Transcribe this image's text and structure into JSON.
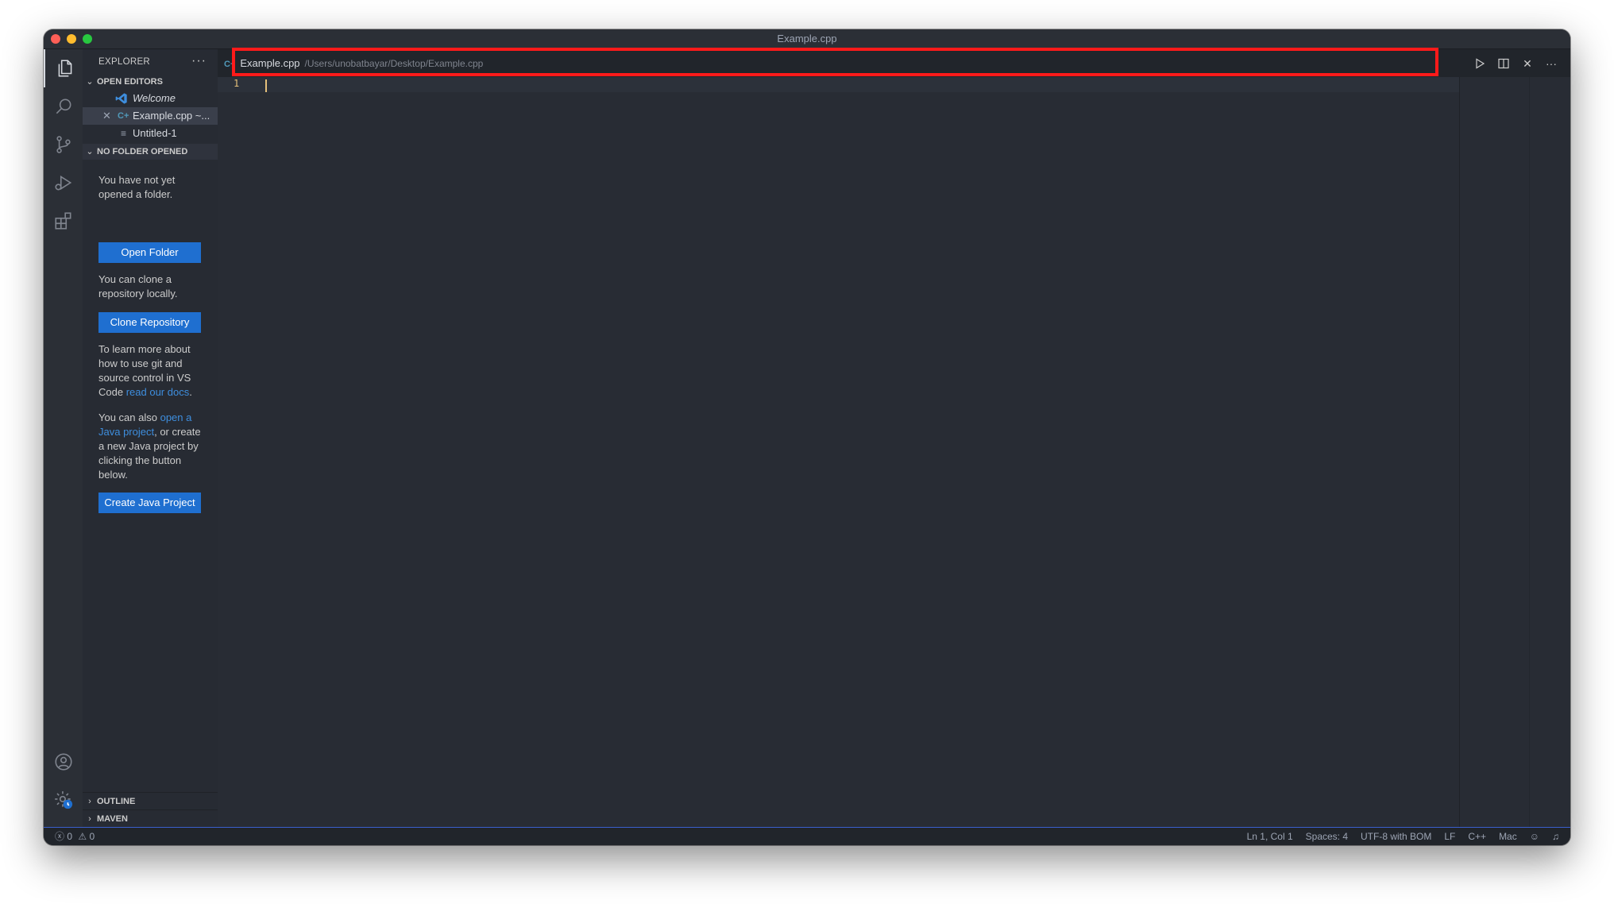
{
  "window": {
    "title": "Example.cpp"
  },
  "activity_bar": {
    "icons": [
      "files-icon",
      "search-icon",
      "source-control-icon",
      "run-debug-icon",
      "extensions-icon",
      "account-icon",
      "settings-gear-icon"
    ]
  },
  "sidebar": {
    "title": "EXPLORER",
    "more": "···",
    "open_editors": {
      "header": "OPEN EDITORS",
      "items": [
        {
          "label": "Welcome"
        },
        {
          "label": "Example.cpp ~..."
        },
        {
          "label": "Untitled-1"
        }
      ]
    },
    "no_folder": {
      "header": "NO FOLDER OPENED",
      "text1": "You have not yet opened a folder.",
      "open_folder_button": "Open Folder",
      "text2": "You can clone a repository locally.",
      "clone_button": "Clone Repository",
      "text3_prefix": "To learn more about how to use git and source control in VS Code ",
      "text3_link": "read our docs",
      "text3_suffix": ".",
      "text4_prefix": "You can also ",
      "text4_link": "open a Java project",
      "text4_suffix": ", or create a new Java project by clicking the button below.",
      "create_java_button": "Create Java Project"
    },
    "panels": [
      {
        "label": "OUTLINE"
      },
      {
        "label": "MAVEN"
      }
    ]
  },
  "editor": {
    "tab": {
      "filename": "Example.cpp",
      "path": "/Users/unobatbayar/Desktop/Example.cpp"
    },
    "line_number": "1"
  },
  "status_bar": {
    "errors": "0",
    "warnings": "0",
    "position": "Ln 1, Col 1",
    "spaces": "Spaces: 4",
    "encoding": "UTF-8 with BOM",
    "eol": "LF",
    "language": "C++",
    "platform": "Mac"
  },
  "colors": {
    "accent": "#1f6fd0",
    "highlight": "#ff1a1a",
    "link": "#3e8ede"
  }
}
